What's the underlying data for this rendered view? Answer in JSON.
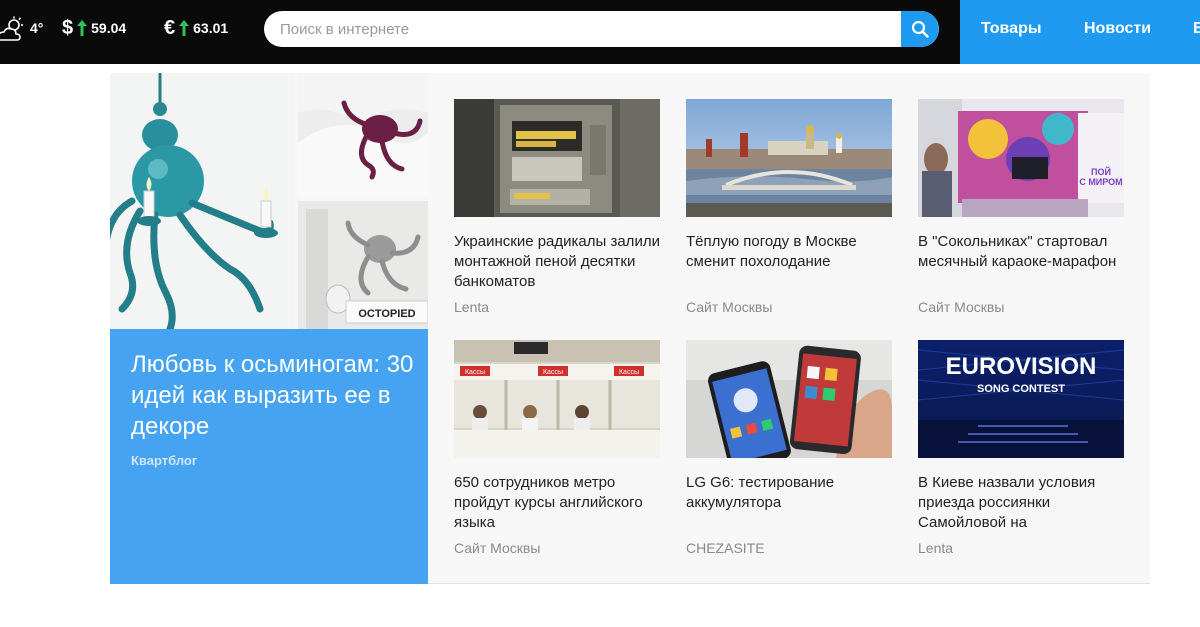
{
  "header": {
    "weather": {
      "icon": "cloud-sun-icon",
      "temperature": "4°"
    },
    "rates": [
      {
        "currency": "$",
        "direction": "up",
        "value": "59.04"
      },
      {
        "currency": "€",
        "direction": "up",
        "value": "63.01"
      }
    ],
    "search": {
      "placeholder": "Поиск в интернете",
      "icon": "search-icon"
    },
    "nav": [
      {
        "label": "Товары"
      },
      {
        "label": "Новости"
      },
      {
        "label": "В"
      }
    ]
  },
  "colors": {
    "topbar": "#0a0a0a",
    "accent": "#1e9bf0",
    "feature_panel": "#45a3f2",
    "rate_up": "#2fc25b"
  },
  "feature": {
    "title": "Любовь к осьминогам: 30 идей как выразить ее в декоре",
    "source": "Квартблог",
    "image_text": "OCTOPIED"
  },
  "news": [
    {
      "title": "Украинские радикалы залили монтажной пеной десятки банкоматов",
      "source": "Lenta"
    },
    {
      "title": "Тёплую погоду в Москве сменит похолодание",
      "source": "Сайт Москвы"
    },
    {
      "title": "В \"Сокольниках\" стартовал месячный караоке-марафон",
      "source": "Сайт Москвы"
    },
    {
      "title": "650 сотрудников метро пройдут курсы английского языка",
      "source": "Сайт Москвы"
    },
    {
      "title": "LG G6: тестирование аккумулятора",
      "source": "CHEZASITE"
    },
    {
      "title": "В Киеве назвали условия приезда россиянки Самойловой на",
      "source": "Lenta"
    }
  ],
  "image_texts": {
    "metro_sign": "Кассы",
    "eurovision_logo": "EUROVISION",
    "eurovision_sub": "SONG CONTEST"
  }
}
